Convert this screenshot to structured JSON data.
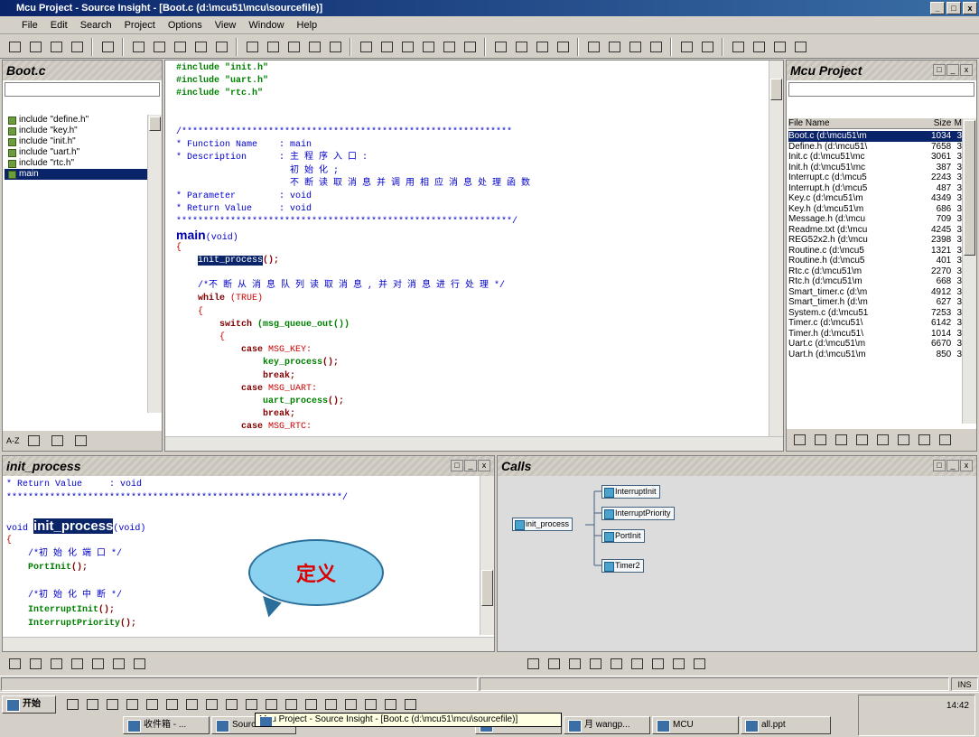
{
  "window": {
    "title": "Mcu Project - Source Insight - [Boot.c (d:\\mcu51\\mcu\\sourcefile)]",
    "buttons": [
      "_",
      "□",
      "x"
    ]
  },
  "menu": [
    "File",
    "Edit",
    "Search",
    "Project",
    "Options",
    "View",
    "Window",
    "Help"
  ],
  "symbol_window": {
    "title": "Boot.c",
    "items": [
      {
        "label": "include \"define.h\"",
        "selected": false
      },
      {
        "label": "include \"key.h\"",
        "selected": false
      },
      {
        "label": "include \"init.h\"",
        "selected": false
      },
      {
        "label": "include \"uart.h\"",
        "selected": false
      },
      {
        "label": "include \"rtc.h\"",
        "selected": false
      },
      {
        "label": "main",
        "selected": true
      }
    ],
    "bottom_tool": "A-Z"
  },
  "editor": {
    "lines": [
      [
        {
          "t": "#include ",
          "c": "green"
        },
        {
          "t": "\"init.h\"",
          "c": "green"
        }
      ],
      [
        {
          "t": "#include ",
          "c": "green"
        },
        {
          "t": "\"uart.h\"",
          "c": "green"
        }
      ],
      [
        {
          "t": "#include ",
          "c": "green"
        },
        {
          "t": "\"rtc.h\"",
          "c": "green"
        }
      ],
      [
        {
          "t": "",
          "c": ""
        }
      ],
      [
        {
          "t": "",
          "c": ""
        }
      ],
      [
        {
          "t": "/*************************************************************",
          "c": "blue"
        }
      ],
      [
        {
          "t": "* Function Name    : main",
          "c": "blue"
        }
      ],
      [
        {
          "t": "* Description      : 主 程 序 入 口 :",
          "c": "blue"
        }
      ],
      [
        {
          "t": "                     初 始 化 ;",
          "c": "blue"
        }
      ],
      [
        {
          "t": "                     不 断 读 取 消 息 并 调 用 相 应 消 息 处 理 函 数",
          "c": "blue"
        }
      ],
      [
        {
          "t": "* Parameter        : void",
          "c": "blue"
        }
      ],
      [
        {
          "t": "* Return Value     : void",
          "c": "blue"
        }
      ],
      [
        {
          "t": "**************************************************************/",
          "c": "blue"
        }
      ],
      [
        {
          "t": "main",
          "c": "big"
        },
        {
          "t": "(void)",
          "c": "blue"
        }
      ],
      [
        {
          "t": "{",
          "c": "red"
        }
      ],
      [
        {
          "t": "    ",
          "c": ""
        },
        {
          "t": "init_process",
          "c": "sel"
        },
        {
          "t": "();",
          "c": "maroon"
        }
      ],
      [
        {
          "t": "",
          "c": ""
        }
      ],
      [
        {
          "t": "    /*不 断 从 消 息 队 列 读 取 消 息 , 并 对 消 息 进 行 处 理 */",
          "c": "blue"
        }
      ],
      [
        {
          "t": "    while ",
          "c": "maroon"
        },
        {
          "t": "(TRUE)",
          "c": "red"
        }
      ],
      [
        {
          "t": "    {",
          "c": "red"
        }
      ],
      [
        {
          "t": "        switch ",
          "c": "maroon"
        },
        {
          "t": "(msg_queue_out())",
          "c": "green"
        }
      ],
      [
        {
          "t": "        {",
          "c": "red"
        }
      ],
      [
        {
          "t": "            case ",
          "c": "maroon"
        },
        {
          "t": "MSG_KEY:",
          "c": "red"
        }
      ],
      [
        {
          "t": "                key_process",
          "c": "green"
        },
        {
          "t": "();",
          "c": "maroon"
        }
      ],
      [
        {
          "t": "                break;",
          "c": "maroon"
        }
      ],
      [
        {
          "t": "            case ",
          "c": "maroon"
        },
        {
          "t": "MSG_UART:",
          "c": "red"
        }
      ],
      [
        {
          "t": "                uart_process",
          "c": "green"
        },
        {
          "t": "();",
          "c": "maroon"
        }
      ],
      [
        {
          "t": "                break;",
          "c": "maroon"
        }
      ],
      [
        {
          "t": "            case ",
          "c": "maroon"
        },
        {
          "t": "MSG_RTC:",
          "c": "red"
        }
      ]
    ]
  },
  "project_window": {
    "title": "Mcu Project",
    "headers": [
      "File Name",
      "Size",
      "M"
    ],
    "files": [
      [
        "Boot.c (d:\\mcu51\\m",
        "1034",
        "3"
      ],
      [
        "Define.h (d:\\mcu51\\",
        "7658",
        "3"
      ],
      [
        "Init.c (d:\\mcu51\\mc",
        "3061",
        "3"
      ],
      [
        "Init.h (d:\\mcu51\\mc",
        "387",
        "3"
      ],
      [
        "Interrupt.c (d:\\mcu5",
        "2243",
        "3"
      ],
      [
        "Interrupt.h (d:\\mcu5",
        "487",
        "3"
      ],
      [
        "Key.c (d:\\mcu51\\m",
        "4349",
        "3"
      ],
      [
        "Key.h (d:\\mcu51\\m",
        "686",
        "3"
      ],
      [
        "Message.h (d:\\mcu",
        "709",
        "3"
      ],
      [
        "Readme.txt (d:\\mcu",
        "4245",
        "3"
      ],
      [
        "REG52x2.h (d:\\mcu",
        "2398",
        "3"
      ],
      [
        "Routine.c (d:\\mcu5",
        "1321",
        "3"
      ],
      [
        "Routine.h (d:\\mcu5",
        "401",
        "3"
      ],
      [
        "Rtc.c (d:\\mcu51\\m",
        "2270",
        "3"
      ],
      [
        "Rtc.h (d:\\mcu51\\m",
        "668",
        "3"
      ],
      [
        "Smart_timer.c (d:\\m",
        "4912",
        "3"
      ],
      [
        "Smart_timer.h (d:\\m",
        "627",
        "3"
      ],
      [
        "System.c (d:\\mcu51",
        "7253",
        "3"
      ],
      [
        "Timer.c (d:\\mcu51\\",
        "6142",
        "3"
      ],
      [
        "Timer.h (d:\\mcu51\\",
        "1014",
        "3"
      ],
      [
        "Uart.c (d:\\mcu51\\m",
        "6670",
        "3"
      ],
      [
        "Uart.h (d:\\mcu51\\m",
        "850",
        "3"
      ]
    ]
  },
  "context_window": {
    "title": "init_process",
    "lines": [
      [
        {
          "t": "* Return Value     : void",
          "c": "blue"
        }
      ],
      [
        {
          "t": "**************************************************************/",
          "c": "blue"
        }
      ],
      [
        {
          "t": "",
          "c": ""
        }
      ],
      [
        {
          "t": "void ",
          "c": "blue"
        },
        {
          "t": "init_process",
          "c": "bigsel"
        },
        {
          "t": "(void)",
          "c": "blue"
        }
      ],
      [
        {
          "t": "{",
          "c": "red"
        }
      ],
      [
        {
          "t": "    /*初 始 化 端 口 */",
          "c": "blue"
        }
      ],
      [
        {
          "t": "    PortInit",
          "c": "green"
        },
        {
          "t": "();",
          "c": "maroon"
        }
      ],
      [
        {
          "t": "",
          "c": ""
        }
      ],
      [
        {
          "t": "    /*初 始 化 中 断 */",
          "c": "blue"
        }
      ],
      [
        {
          "t": "    InterruptInit",
          "c": "green"
        },
        {
          "t": "();",
          "c": "maroon"
        }
      ],
      [
        {
          "t": "    InterruptPriority",
          "c": "green"
        },
        {
          "t": "();",
          "c": "maroon"
        }
      ]
    ],
    "balloon_text": "定义"
  },
  "calls_window": {
    "title": "Calls",
    "root": "init_process",
    "children": [
      "InterruptInit",
      "InterruptPriority",
      "PortInit",
      "Timer2"
    ]
  },
  "status": {
    "mode": "INS"
  },
  "taskbar": {
    "start": "开始",
    "clock": "14:42",
    "tasks": [
      "收件箱 - ...",
      "SourceInsi...",
      "Mcu Project - Source Insight - [Boot.c (d:\\mcu51\\mcu\\sourcefile)]",
      "",
      "月 wangp...",
      "MCU",
      "all.ppt"
    ]
  }
}
